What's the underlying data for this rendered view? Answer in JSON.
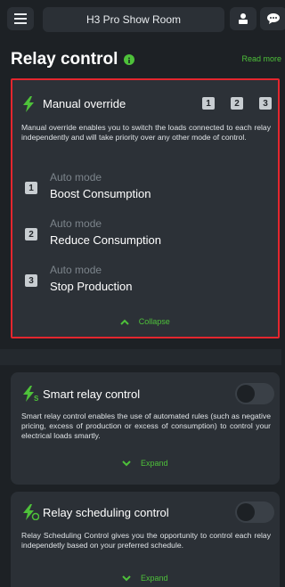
{
  "header": {
    "title": "H3 Pro Show Room"
  },
  "section": {
    "title": "Relay control",
    "read_more": "Read more"
  },
  "manual": {
    "title": "Manual override",
    "badges": [
      "1",
      "2",
      "3"
    ],
    "description": "Manual override enables you to switch the loads connected to each relay independently and will take priority over any other mode of control.",
    "relays": [
      {
        "number": "1",
        "mode_label": "Auto mode",
        "mode_value": "Boost Consumption"
      },
      {
        "number": "2",
        "mode_label": "Auto mode",
        "mode_value": "Reduce Consumption"
      },
      {
        "number": "3",
        "mode_label": "Auto mode",
        "mode_value": "Stop Production"
      }
    ],
    "collapse_label": "Collapse"
  },
  "smart": {
    "title": "Smart relay control",
    "description": "Smart relay control enables the use of automated rules (such as negative pricing, excess of production or excess of consumption) to control your electrical loads smartly.",
    "expand_label": "Expand",
    "enabled": false
  },
  "scheduling": {
    "title": "Relay scheduling control",
    "description": "Relay Scheduling Control gives you the opportunity to control each relay independetly based on your preferred schedule.",
    "expand_label": "Expand",
    "enabled": false
  },
  "colors": {
    "accent": "#4ec13a",
    "highlight": "#e4262e",
    "background": "#1d2125",
    "card": "#2b3036"
  },
  "icons": {
    "menu": "hamburger-icon",
    "profile": "person-icon",
    "chat": "chat-bubble-icon",
    "info": "info-icon",
    "bolt": "lightning-bolt-icon"
  }
}
